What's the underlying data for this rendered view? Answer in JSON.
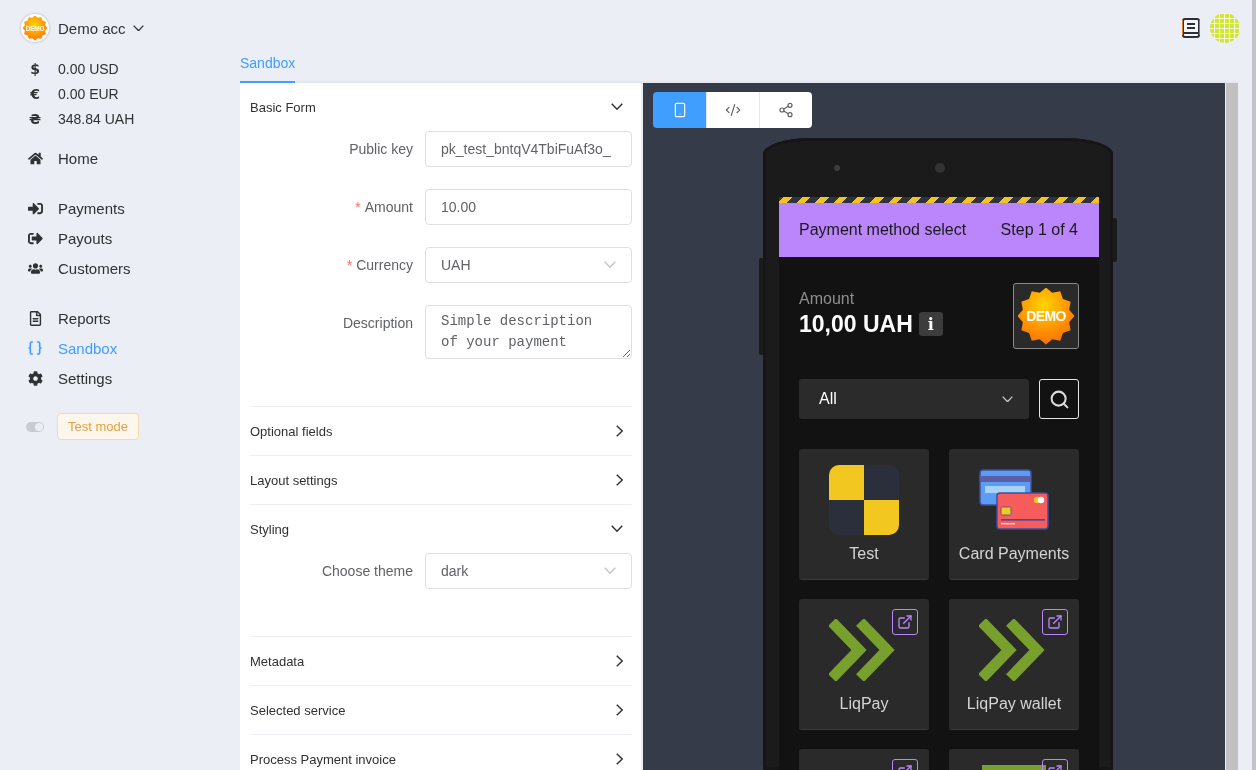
{
  "account": {
    "logo_text": "DEMO",
    "name": "Demo acc"
  },
  "balances": [
    {
      "symbol": "$",
      "amount": "0.00 USD"
    },
    {
      "symbol": "€",
      "amount": "0.00 EUR"
    },
    {
      "symbol": "₴",
      "amount": "348.84 UAH"
    }
  ],
  "nav_groups": [
    {
      "items": [
        {
          "label": "Home",
          "selected": false
        }
      ]
    },
    {
      "items": [
        {
          "label": "Payments",
          "selected": false
        },
        {
          "label": "Payouts",
          "selected": false
        },
        {
          "label": "Customers",
          "selected": false
        }
      ]
    },
    {
      "items": [
        {
          "label": "Reports",
          "selected": false
        },
        {
          "label": "Sandbox",
          "selected": true
        },
        {
          "label": "Settings",
          "selected": false
        }
      ]
    }
  ],
  "test_mode": {
    "switch": {
      "on": true,
      "disabled": true
    },
    "tag": "Test mode"
  },
  "tabs": [
    {
      "label": "Sandbox",
      "selected": true
    }
  ],
  "form_sections": [
    {
      "title": "Basic Form",
      "expanded": true,
      "fields": [
        {
          "kind": "input",
          "label": "Public key",
          "value": "pk_test_bntqV4TbiFuAf3o_"
        },
        {
          "kind": "input",
          "label": "Amount",
          "required_mark": "*",
          "value": "10.00"
        },
        {
          "kind": "select",
          "label": "Currency",
          "required_mark": "*",
          "value": "UAH"
        },
        {
          "kind": "textarea",
          "label": "Description",
          "value": "Simple description of your payment"
        }
      ]
    },
    {
      "title": "Optional fields",
      "expanded": false
    },
    {
      "title": "Layout settings",
      "expanded": false
    },
    {
      "title": "Styling",
      "expanded": true,
      "fields": [
        {
          "kind": "select",
          "label": "Choose theme",
          "value": "dark"
        }
      ]
    },
    {
      "title": "Metadata",
      "expanded": false
    },
    {
      "title": "Selected service",
      "expanded": false
    },
    {
      "title": "Process Payment invoice",
      "expanded": false
    }
  ],
  "preview": {
    "view_buttons": [
      {
        "selected": true
      },
      {
        "selected": false
      },
      {
        "selected": false
      }
    ],
    "checkout": {
      "title": "Payment method select",
      "step": "Step 1 of 4",
      "amount_label": "Amount",
      "amount": "10,00 UAH",
      "info_badge": "i",
      "logo_text": "DEMO",
      "filter": "All",
      "methods": [
        {
          "kind": "checker",
          "label": "Test",
          "external": false
        },
        {
          "kind": "cards",
          "label": "Card Payments",
          "external": false
        },
        {
          "kind": "chevrons",
          "label": "LiqPay",
          "external": true
        },
        {
          "kind": "chevrons",
          "label": "LiqPay wallet",
          "external": true
        },
        {
          "kind": "none",
          "external": true
        },
        {
          "kind": "stripe",
          "external": true
        }
      ]
    }
  }
}
